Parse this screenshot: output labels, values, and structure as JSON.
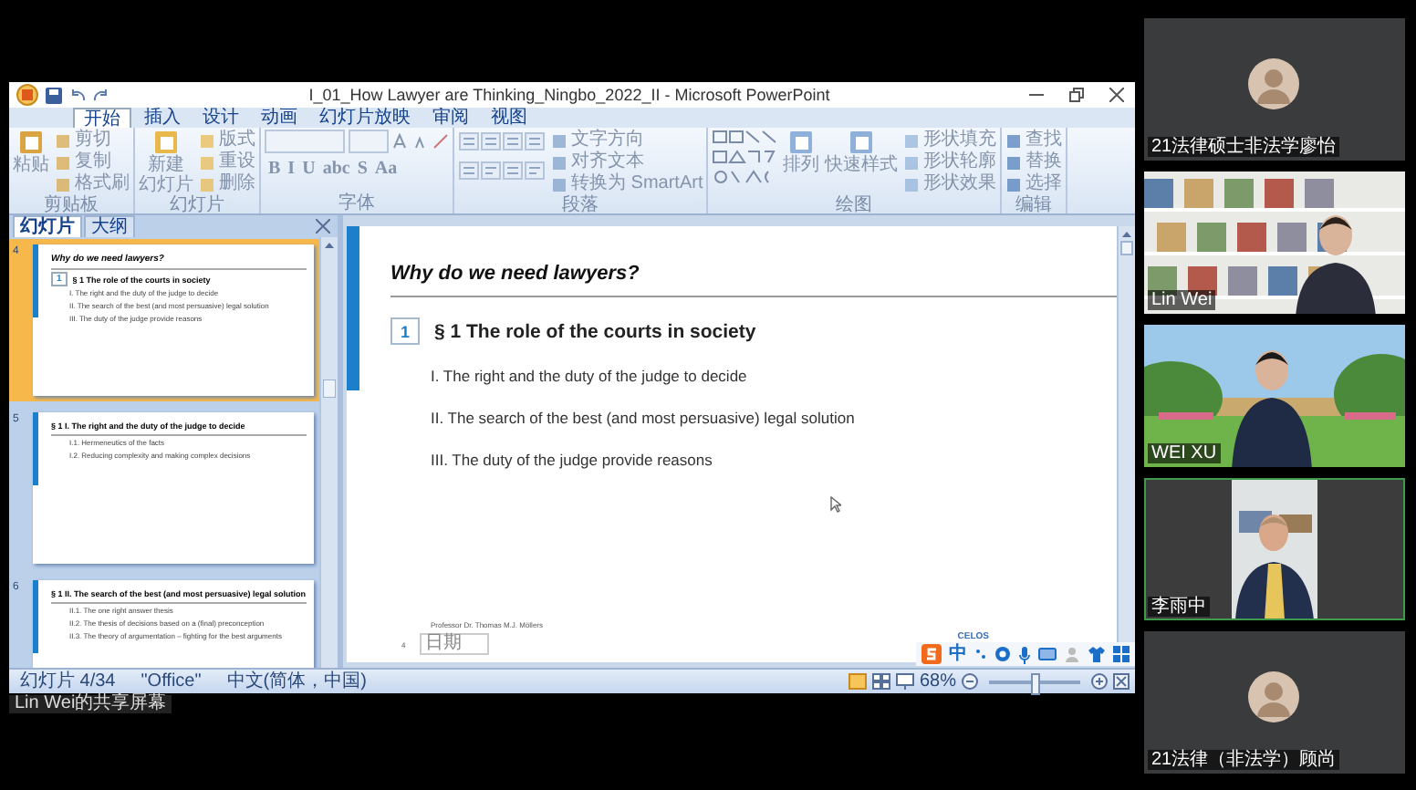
{
  "window": {
    "title": "I_01_How Lawyer are Thinking_Ningbo_2022_II - Microsoft PowerPoint"
  },
  "ribbon_tabs": [
    {
      "label": "开始",
      "selected": true
    },
    {
      "label": "插入",
      "selected": false
    },
    {
      "label": "设计",
      "selected": false
    },
    {
      "label": "动画",
      "selected": false
    },
    {
      "label": "幻灯片放映",
      "selected": false
    },
    {
      "label": "审阅",
      "selected": false
    },
    {
      "label": "视图",
      "selected": false
    }
  ],
  "ribbon_groups": [
    {
      "kind": "clipboard",
      "label": "剪贴板",
      "big_buttons": [
        [
          "粘贴"
        ]
      ],
      "items": [
        "剪切",
        "复制",
        "格式刷"
      ]
    },
    {
      "kind": "slides",
      "label": "幻灯片",
      "big_buttons": [
        [
          "新建",
          "幻灯片"
        ]
      ],
      "items": [
        "版式",
        "重设",
        "删除"
      ]
    },
    {
      "kind": "font",
      "label": "字体",
      "buttons": [
        "B",
        "I",
        "U",
        "abc",
        "S",
        "Aa"
      ]
    },
    {
      "kind": "paragraph",
      "label": "段落",
      "items": [
        "文字方向",
        "对齐文本",
        "转换为 SmartArt"
      ]
    },
    {
      "kind": "drawing",
      "label": "绘图",
      "big_buttons": [
        [
          "排列"
        ],
        [
          "快速样式"
        ]
      ],
      "items": [
        "形状填充",
        "形状轮廓",
        "形状效果"
      ]
    },
    {
      "kind": "editing",
      "label": "编辑",
      "items": [
        "查找",
        "替换",
        "选择"
      ]
    }
  ],
  "pane_tabs": [
    {
      "label": "幻灯片",
      "selected": true
    },
    {
      "label": "大纲",
      "selected": false
    }
  ],
  "thumbnails": [
    {
      "number": "4",
      "selected": true,
      "title": "Why do we need lawyers?",
      "section_number": "1",
      "heading": "§ 1 The role of the courts in society",
      "items": [
        "I. The right and the duty of the judge to decide",
        "II. The search of the best (and most persuasive) legal solution",
        "III. The duty of the judge provide reasons"
      ]
    },
    {
      "number": "5",
      "selected": false,
      "heading": "§ 1 I. The right and the duty of the judge to decide",
      "items": [
        "I.1. Hermeneutics of the facts",
        "I.2. Reducing complexity and making complex decisions"
      ]
    },
    {
      "number": "6",
      "selected": false,
      "heading": "§ 1 II. The search of the best (and most persuasive) legal solution",
      "items": [
        "II.1. The one right answer thesis",
        "II.2. The thesis of decisions based on a (final) preconception",
        "II.3. The theory of argumentation – fighting for the best arguments"
      ]
    }
  ],
  "slide": {
    "title": "Why do we need lawyers?",
    "section_number": "1",
    "heading": "§ 1 The role of the courts in society",
    "items": [
      "I. The right and the duty of the judge to decide",
      "II. The search of the best (and most persuasive) legal solution",
      "III. The duty of the judge provide reasons"
    ],
    "author": "Professor Dr. Thomas M.J. Möllers",
    "slide_number": "4",
    "date_box": "日期",
    "logo_text": "CELOS"
  },
  "input_method_bar": {
    "mode": "中"
  },
  "status_bar": {
    "texts": [
      "幻灯片 4/34",
      "\"Office\"",
      "中文(简体，中国)"
    ],
    "zoom": "68%",
    "zoom_slider": {
      "level": 0.5
    }
  },
  "share_caption": "Lin Wei的共享屏幕",
  "participants": [
    {
      "kind": "avatar",
      "name": "21法律硕士非法学廖怡",
      "speaking": false
    },
    {
      "kind": "bookshelf",
      "name": "Lin Wei",
      "speaking": false
    },
    {
      "kind": "garden",
      "name": "WEI XU",
      "speaking": false
    },
    {
      "kind": "office",
      "name": "李雨中",
      "speaking": true
    },
    {
      "kind": "avatar",
      "name": "21法律（非法学）顾尚",
      "speaking": false
    }
  ]
}
